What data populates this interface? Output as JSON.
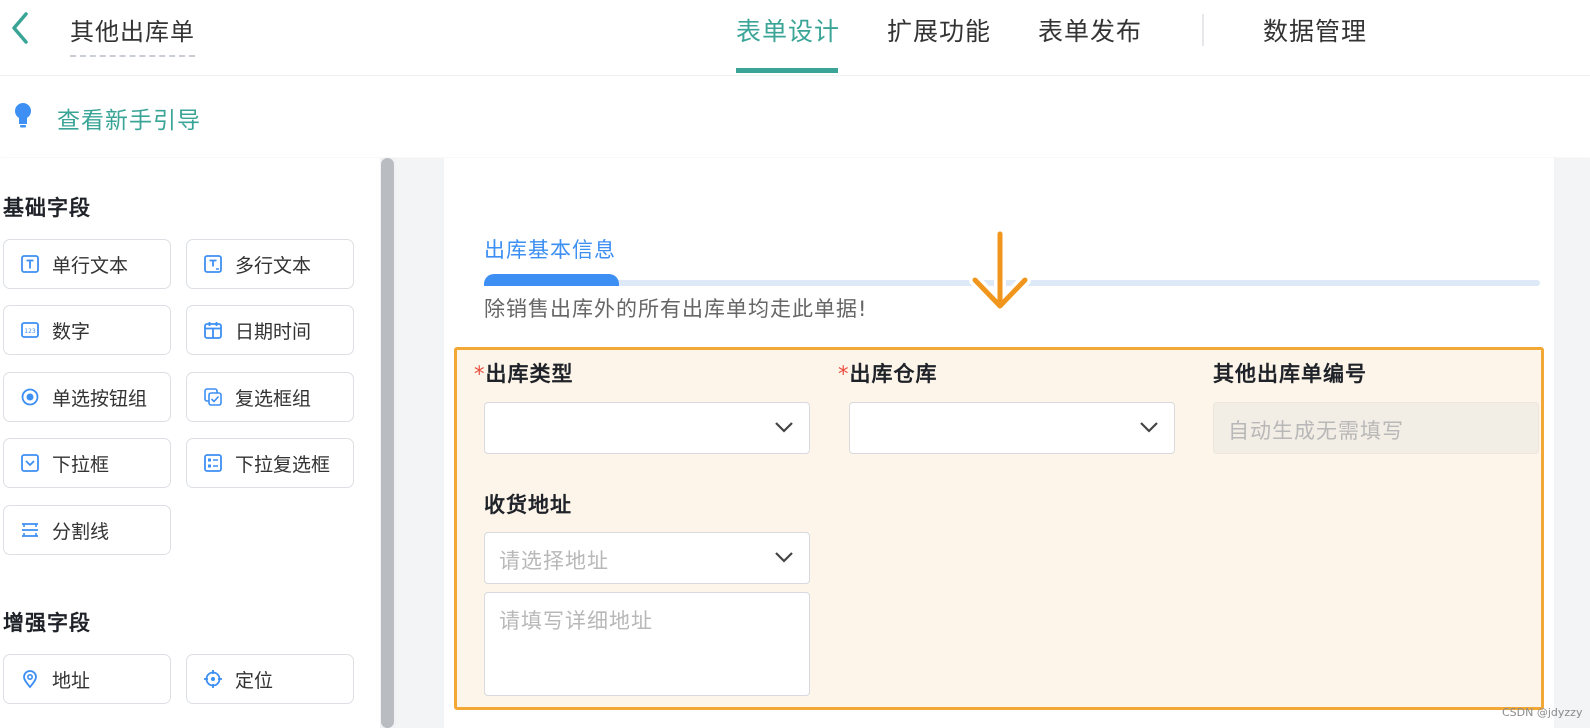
{
  "header": {
    "title": "其他出库单",
    "tabs": [
      {
        "label": "表单设计",
        "active": true
      },
      {
        "label": "扩展功能",
        "active": false
      },
      {
        "label": "表单发布",
        "active": false
      },
      {
        "label": "数据管理",
        "active": false
      }
    ]
  },
  "guide": {
    "label": "查看新手引导"
  },
  "sidebar": {
    "basic_title": "基础字段",
    "basic_fields": [
      {
        "label": "单行文本",
        "icon": "single-line-text-icon"
      },
      {
        "label": "多行文本",
        "icon": "multi-line-text-icon"
      },
      {
        "label": "数字",
        "icon": "number-icon"
      },
      {
        "label": "日期时间",
        "icon": "calendar-icon"
      },
      {
        "label": "单选按钮组",
        "icon": "radio-icon"
      },
      {
        "label": "复选框组",
        "icon": "checkbox-icon"
      },
      {
        "label": "下拉框",
        "icon": "dropdown-icon"
      },
      {
        "label": "下拉复选框",
        "icon": "dropdown-checkbox-icon"
      },
      {
        "label": "分割线",
        "icon": "divider-icon"
      }
    ],
    "enhanced_title": "增强字段",
    "enhanced_fields": [
      {
        "label": "地址",
        "icon": "location-pin-icon"
      },
      {
        "label": "定位",
        "icon": "crosshair-icon"
      }
    ]
  },
  "form": {
    "section_title": "出库基本信息",
    "section_desc": "除销售出库外的所有出库单均走此单据!",
    "fields": {
      "type": {
        "required_mark": "*",
        "label": "出库类型",
        "value": ""
      },
      "warehouse": {
        "required_mark": "*",
        "label": "出库仓库",
        "value": ""
      },
      "number": {
        "label": "其他出库单编号",
        "placeholder": "自动生成无需填写"
      },
      "address": {
        "label": "收货地址",
        "select_placeholder": "请选择地址",
        "detail_placeholder": "请填写详细地址"
      }
    }
  },
  "watermark": "CSDN @jdyzzy",
  "colors": {
    "accent": "#3aa597",
    "section_blue": "#3d8ff3",
    "highlight_border": "#f3a835",
    "highlight_bg": "#fdf5e9",
    "required": "#e84d3d"
  }
}
